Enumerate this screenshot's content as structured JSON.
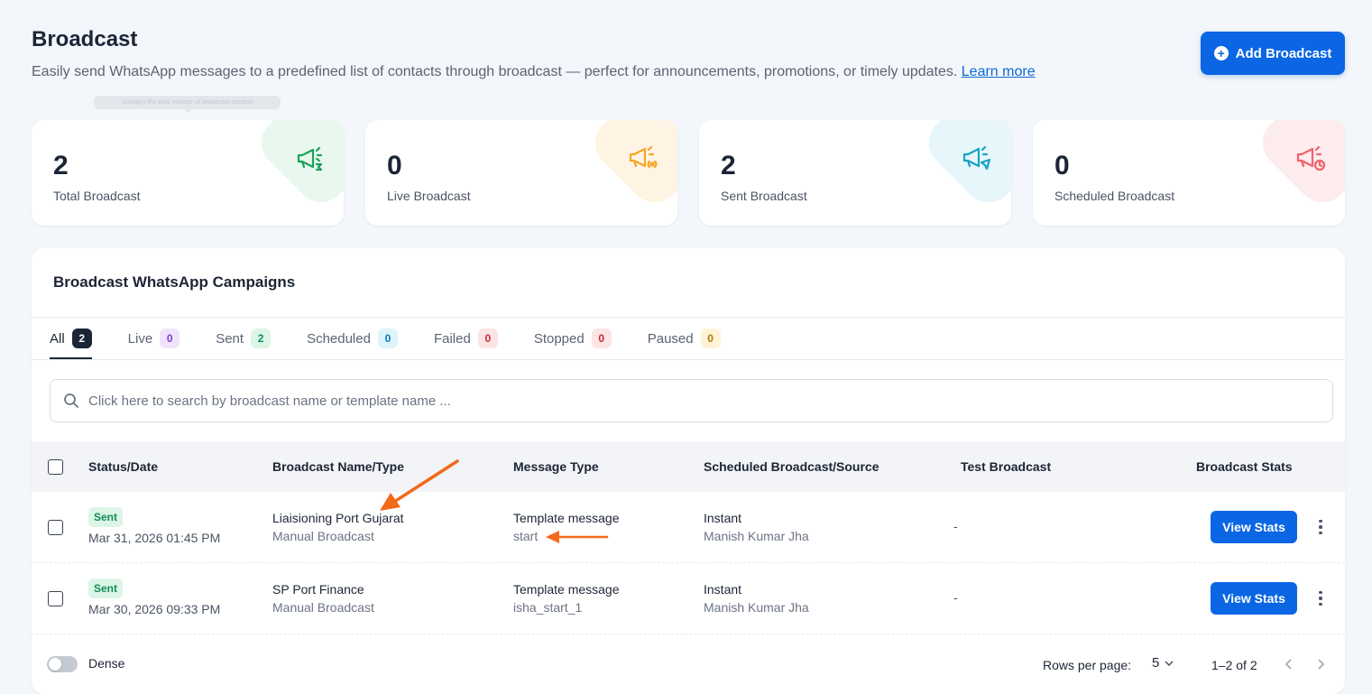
{
  "header": {
    "title": "Broadcast",
    "description": "Easily send WhatsApp messages to a predefined list of contacts through broadcast — perfect for announcements, promotions, or timely updates.",
    "learn_more": "Learn more",
    "add_button": "Add Broadcast",
    "tooltip": "Displays the total number of broadcast created"
  },
  "stats": [
    {
      "value": "2",
      "label": "Total Broadcast",
      "icon": "megaphone-sigma-icon",
      "color": "#1aa35a",
      "bg": "#e9f8ef"
    },
    {
      "value": "0",
      "label": "Live Broadcast",
      "icon": "megaphone-live-icon",
      "color": "#f5a524",
      "bg": "#fff4e3"
    },
    {
      "value": "2",
      "label": "Sent Broadcast",
      "icon": "megaphone-send-icon",
      "color": "#17a2c4",
      "bg": "#e6f6fb"
    },
    {
      "value": "0",
      "label": "Scheduled Broadcast",
      "icon": "megaphone-clock-icon",
      "color": "#f0616d",
      "bg": "#fdeced"
    }
  ],
  "campaigns": {
    "title": "Broadcast WhatsApp Campaigns",
    "tabs": [
      {
        "label": "All",
        "count": "2",
        "badge_bg": "#1c2536",
        "badge_color": "#ffffff"
      },
      {
        "label": "Live",
        "count": "0",
        "badge_bg": "#efe4fc",
        "badge_color": "#7a3fd1"
      },
      {
        "label": "Sent",
        "count": "2",
        "badge_bg": "#dcf5e7",
        "badge_color": "#118d57"
      },
      {
        "label": "Scheduled",
        "count": "0",
        "badge_bg": "#dff3fb",
        "badge_color": "#0a7bb5"
      },
      {
        "label": "Failed",
        "count": "0",
        "badge_bg": "#fde4e4",
        "badge_color": "#c6283a"
      },
      {
        "label": "Stopped",
        "count": "0",
        "badge_bg": "#fde4e4",
        "badge_color": "#c6283a"
      },
      {
        "label": "Paused",
        "count": "0",
        "badge_bg": "#fff3d6",
        "badge_color": "#b07a0a"
      }
    ],
    "search_placeholder": "Click here to search by broadcast name or template name ...",
    "columns": [
      "Status/Date",
      "Broadcast Name/Type",
      "Message Type",
      "Scheduled Broadcast/Source",
      "Test Broadcast",
      "Broadcast Stats"
    ],
    "rows": [
      {
        "status": "Sent",
        "date": "Mar 31, 2026 01:45 PM",
        "name": "Liaisioning Port Gujarat",
        "type": "Manual Broadcast",
        "message_type": "Template message",
        "template": "start",
        "schedule": "Instant",
        "source": "Manish Kumar Jha",
        "test": "-",
        "action": "View Stats"
      },
      {
        "status": "Sent",
        "date": "Mar 30, 2026 09:33 PM",
        "name": "SP Port Finance",
        "type": "Manual Broadcast",
        "message_type": "Template message",
        "template": "isha_start_1",
        "schedule": "Instant",
        "source": "Manish Kumar Jha",
        "test": "-",
        "action": "View Stats"
      }
    ],
    "footer": {
      "dense_label": "Dense",
      "rows_per_page_label": "Rows per page:",
      "rows_per_page": "5",
      "range": "1–2 of 2"
    }
  },
  "annotation_color": "#f26a1b"
}
